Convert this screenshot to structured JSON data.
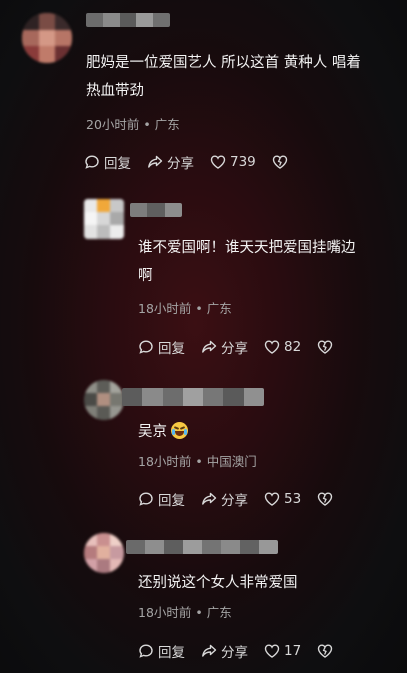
{
  "comments": [
    {
      "text": "肥妈是一位爱国艺人 所以这首 黄种人 唱着\n热血带劲",
      "meta": "20小时前 • 广东",
      "reply_label": "回复",
      "share_label": "分享",
      "like_count": "739"
    },
    {
      "text": "谁不爱国啊！谁天天把爱国挂嘴边\n啊",
      "meta": "18小时前 • 广东",
      "reply_label": "回复",
      "share_label": "分享",
      "like_count": "82"
    },
    {
      "text": "吴京",
      "meta": "18小时前 • 中国澳门",
      "reply_label": "回复",
      "share_label": "分享",
      "like_count": "53",
      "emoji": "crying-laughing-emoji"
    },
    {
      "text": "还别说这个女人非常爱国",
      "meta": "18小时前 • 广东",
      "reply_label": "回复",
      "share_label": "分享",
      "like_count": "17"
    }
  ],
  "colors": {
    "text": "#f3f3f3",
    "meta": "#a5a5a5",
    "background_glow": "#3b0f13"
  }
}
